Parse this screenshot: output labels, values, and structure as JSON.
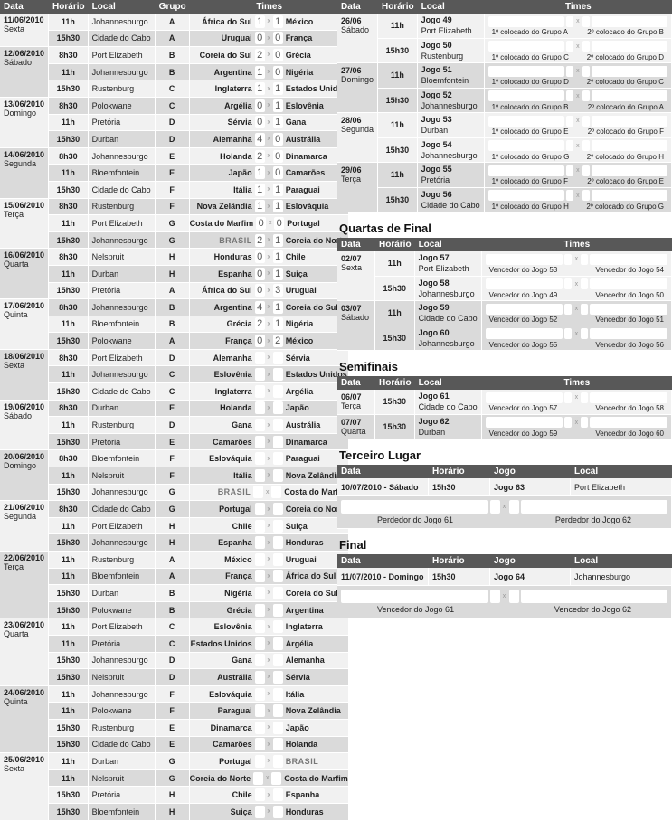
{
  "group_stage": {
    "headers": {
      "data": "Data",
      "horario": "Horário",
      "local": "Local",
      "grupo": "Grupo",
      "times": "Times"
    },
    "days": [
      {
        "date": "11/06/2010",
        "weekday": "Sexta",
        "matches": [
          {
            "time": "11h",
            "venue": "Johannesburgo",
            "group": "A",
            "home": "África do Sul",
            "hs": "1",
            "as": "1",
            "away": "México"
          },
          {
            "time": "15h30",
            "venue": "Cidade do Cabo",
            "group": "A",
            "home": "Uruguai",
            "hs": "0",
            "as": "0",
            "away": "França"
          }
        ]
      },
      {
        "date": "12/06/2010",
        "weekday": "Sábado",
        "matches": [
          {
            "time": "8h30",
            "venue": "Port Elizabeth",
            "group": "B",
            "home": "Coreia do Sul",
            "hs": "2",
            "as": "0",
            "away": "Grécia"
          },
          {
            "time": "11h",
            "venue": "Johannesburgo",
            "group": "B",
            "home": "Argentina",
            "hs": "1",
            "as": "0",
            "away": "Nigéria"
          },
          {
            "time": "15h30",
            "venue": "Rustenburg",
            "group": "C",
            "home": "Inglaterra",
            "hs": "1",
            "as": "1",
            "away": "Estados Unidos"
          }
        ]
      },
      {
        "date": "13/06/2010",
        "weekday": "Domingo",
        "matches": [
          {
            "time": "8h30",
            "venue": "Polokwane",
            "group": "C",
            "home": "Argélia",
            "hs": "0",
            "as": "1",
            "away": "Eslovênia"
          },
          {
            "time": "11h",
            "venue": "Pretória",
            "group": "D",
            "home": "Sérvia",
            "hs": "0",
            "as": "1",
            "away": "Gana"
          },
          {
            "time": "15h30",
            "venue": "Durban",
            "group": "D",
            "home": "Alemanha",
            "hs": "4",
            "as": "0",
            "away": "Austrália"
          }
        ]
      },
      {
        "date": "14/06/2010",
        "weekday": "Segunda",
        "matches": [
          {
            "time": "8h30",
            "venue": "Johannesburgo",
            "group": "E",
            "home": "Holanda",
            "hs": "2",
            "as": "0",
            "away": "Dinamarca"
          },
          {
            "time": "11h",
            "venue": "Bloemfontein",
            "group": "E",
            "home": "Japão",
            "hs": "1",
            "as": "0",
            "away": "Camarões"
          },
          {
            "time": "15h30",
            "venue": "Cidade do Cabo",
            "group": "F",
            "home": "Itália",
            "hs": "1",
            "as": "1",
            "away": "Paraguai"
          }
        ]
      },
      {
        "date": "15/06/2010",
        "weekday": "Terça",
        "matches": [
          {
            "time": "8h30",
            "venue": "Rustenburg",
            "group": "F",
            "home": "Nova Zelândia",
            "hs": "1",
            "as": "1",
            "away": "Eslováquia"
          },
          {
            "time": "11h",
            "venue": "Port Elizabeth",
            "group": "G",
            "home": "Costa do Marfim",
            "hs": "0",
            "as": "0",
            "away": "Portugal"
          },
          {
            "time": "15h30",
            "venue": "Johannesburgo",
            "group": "G",
            "home": "BRASIL",
            "hs": "2",
            "as": "1",
            "away": "Coreia do Norte"
          }
        ]
      },
      {
        "date": "16/06/2010",
        "weekday": "Quarta",
        "matches": [
          {
            "time": "8h30",
            "venue": "Nelspruit",
            "group": "H",
            "home": "Honduras",
            "hs": "0",
            "as": "1",
            "away": "Chile"
          },
          {
            "time": "11h",
            "venue": "Durban",
            "group": "H",
            "home": "Espanha",
            "hs": "0",
            "as": "1",
            "away": "Suiça"
          },
          {
            "time": "15h30",
            "venue": "Pretória",
            "group": "A",
            "home": "África do Sul",
            "hs": "0",
            "as": "3",
            "away": "Uruguai"
          }
        ]
      },
      {
        "date": "17/06/2010",
        "weekday": "Quinta",
        "matches": [
          {
            "time": "8h30",
            "venue": "Johannesburgo",
            "group": "B",
            "home": "Argentina",
            "hs": "4",
            "as": "1",
            "away": "Coreia do Sul"
          },
          {
            "time": "11h",
            "venue": "Bloemfontein",
            "group": "B",
            "home": "Grécia",
            "hs": "2",
            "as": "1",
            "away": "Nigéria"
          },
          {
            "time": "15h30",
            "venue": "Polokwane",
            "group": "A",
            "home": "França",
            "hs": "0",
            "as": "2",
            "away": "México"
          }
        ]
      },
      {
        "date": "18/06/2010",
        "weekday": "Sexta",
        "matches": [
          {
            "time": "8h30",
            "venue": "Port Elizabeth",
            "group": "D",
            "home": "Alemanha",
            "hs": "",
            "as": "",
            "away": "Sérvia"
          },
          {
            "time": "11h",
            "venue": "Johannesburgo",
            "group": "C",
            "home": "Eslovênia",
            "hs": "",
            "as": "",
            "away": "Estados Unidos"
          },
          {
            "time": "15h30",
            "venue": "Cidade do Cabo",
            "group": "C",
            "home": "Inglaterra",
            "hs": "",
            "as": "",
            "away": "Argélia"
          }
        ]
      },
      {
        "date": "19/06/2010",
        "weekday": "Sábado",
        "matches": [
          {
            "time": "8h30",
            "venue": "Durban",
            "group": "E",
            "home": "Holanda",
            "hs": "",
            "as": "",
            "away": "Japão"
          },
          {
            "time": "11h",
            "venue": "Rustenburg",
            "group": "D",
            "home": "Gana",
            "hs": "",
            "as": "",
            "away": "Austrália"
          },
          {
            "time": "15h30",
            "venue": "Pretória",
            "group": "E",
            "home": "Camarões",
            "hs": "",
            "as": "",
            "away": "Dinamarca"
          }
        ]
      },
      {
        "date": "20/06/2010",
        "weekday": "Domingo",
        "matches": [
          {
            "time": "8h30",
            "venue": "Bloemfontein",
            "group": "F",
            "home": "Eslováquia",
            "hs": "",
            "as": "",
            "away": "Paraguai"
          },
          {
            "time": "11h",
            "venue": "Nelspruit",
            "group": "F",
            "home": "Itália",
            "hs": "",
            "as": "",
            "away": "Nova Zelândia"
          },
          {
            "time": "15h30",
            "venue": "Johannesburgo",
            "group": "G",
            "home": "BRASIL",
            "hs": "",
            "as": "",
            "away": "Costa do Marfim"
          }
        ]
      },
      {
        "date": "21/06/2010",
        "weekday": "Segunda",
        "matches": [
          {
            "time": "8h30",
            "venue": "Cidade do Cabo",
            "group": "G",
            "home": "Portugal",
            "hs": "",
            "as": "",
            "away": "Coreia do Norte"
          },
          {
            "time": "11h",
            "venue": "Port Elizabeth",
            "group": "H",
            "home": "Chile",
            "hs": "",
            "as": "",
            "away": "Suiça"
          },
          {
            "time": "15h30",
            "venue": "Johannesburgo",
            "group": "H",
            "home": "Espanha",
            "hs": "",
            "as": "",
            "away": "Honduras"
          }
        ]
      },
      {
        "date": "22/06/2010",
        "weekday": "Terça",
        "matches": [
          {
            "time": "11h",
            "venue": "Rustenburg",
            "group": "A",
            "home": "México",
            "hs": "",
            "as": "",
            "away": "Uruguai"
          },
          {
            "time": "11h",
            "venue": "Bloemfontein",
            "group": "A",
            "home": "França",
            "hs": "",
            "as": "",
            "away": "África do Sul"
          },
          {
            "time": "15h30",
            "venue": "Durban",
            "group": "B",
            "home": "Nigéria",
            "hs": "",
            "as": "",
            "away": "Coreia do Sul"
          },
          {
            "time": "15h30",
            "venue": "Polokwane",
            "group": "B",
            "home": "Grécia",
            "hs": "",
            "as": "",
            "away": "Argentina"
          }
        ]
      },
      {
        "date": "23/06/2010",
        "weekday": "Quarta",
        "matches": [
          {
            "time": "11h",
            "venue": "Port Elizabeth",
            "group": "C",
            "home": "Eslovênia",
            "hs": "",
            "as": "",
            "away": "Inglaterra"
          },
          {
            "time": "11h",
            "venue": "Pretória",
            "group": "C",
            "home": "Estados Unidos",
            "hs": "",
            "as": "",
            "away": "Argélia"
          },
          {
            "time": "15h30",
            "venue": "Johannesburgo",
            "group": "D",
            "home": "Gana",
            "hs": "",
            "as": "",
            "away": "Alemanha"
          },
          {
            "time": "15h30",
            "venue": "Nelspruit",
            "group": "D",
            "home": "Austrália",
            "hs": "",
            "as": "",
            "away": "Sérvia"
          }
        ]
      },
      {
        "date": "24/06/2010",
        "weekday": "Quinta",
        "matches": [
          {
            "time": "11h",
            "venue": "Johannesburgo",
            "group": "F",
            "home": "Eslováquia",
            "hs": "",
            "as": "",
            "away": "Itália"
          },
          {
            "time": "11h",
            "venue": "Polokwane",
            "group": "F",
            "home": "Paraguai",
            "hs": "",
            "as": "",
            "away": "Nova Zelândia"
          },
          {
            "time": "15h30",
            "venue": "Rustenburg",
            "group": "E",
            "home": "Dinamarca",
            "hs": "",
            "as": "",
            "away": "Japão"
          },
          {
            "time": "15h30",
            "venue": "Cidade do Cabo",
            "group": "E",
            "home": "Camarões",
            "hs": "",
            "as": "",
            "away": "Holanda"
          }
        ]
      },
      {
        "date": "25/06/2010",
        "weekday": "Sexta",
        "matches": [
          {
            "time": "11h",
            "venue": "Durban",
            "group": "G",
            "home": "Portugal",
            "hs": "",
            "as": "",
            "away": "BRASIL"
          },
          {
            "time": "11h",
            "venue": "Nelspruit",
            "group": "G",
            "home": "Coreia do Norte",
            "hs": "",
            "as": "",
            "away": "Costa do Marfim"
          },
          {
            "time": "15h30",
            "venue": "Pretória",
            "group": "H",
            "home": "Chile",
            "hs": "",
            "as": "",
            "away": "Espanha"
          },
          {
            "time": "15h30",
            "venue": "Bloemfontein",
            "group": "H",
            "home": "Suiça",
            "hs": "",
            "as": "",
            "away": "Honduras"
          }
        ]
      }
    ]
  },
  "separator": "x",
  "knockout": {
    "headers": {
      "data": "Data",
      "horario": "Horário",
      "local": "Local",
      "times": "Times"
    },
    "round_of_16": {
      "title": "",
      "days": [
        {
          "date": "26/06",
          "weekday": "Sábado",
          "matches": [
            {
              "time": "11h",
              "game": "Jogo 49",
              "venue": "Port Elizabeth",
              "l1": "1º colocado do Grupo A",
              "l2": "2º colocado do Grupo B"
            },
            {
              "time": "15h30",
              "game": "Jogo 50",
              "venue": "Rustenburg",
              "l1": "1º colocado do Grupo C",
              "l2": "2º colocado do Grupo D"
            }
          ]
        },
        {
          "date": "27/06",
          "weekday": "Domingo",
          "matches": [
            {
              "time": "11h",
              "game": "Jogo 51",
              "venue": "Bloemfontein",
              "l1": "1º colocado do Grupo D",
              "l2": "2º colocado do Grupo C"
            },
            {
              "time": "15h30",
              "game": "Jogo 52",
              "venue": "Johannesburgo",
              "l1": "1º colocado do Grupo B",
              "l2": "2º colocado do Grupo A"
            }
          ]
        },
        {
          "date": "28/06",
          "weekday": "Segunda",
          "matches": [
            {
              "time": "11h",
              "game": "Jogo 53",
              "venue": "Durban",
              "l1": "1º colocado do Grupo E",
              "l2": "2º colocado do Grupo F"
            },
            {
              "time": "15h30",
              "game": "Jogo 54",
              "venue": "Johannesburgo",
              "l1": "1º colocado do Grupo G",
              "l2": "2º colocado do Grupo H"
            }
          ]
        },
        {
          "date": "29/06",
          "weekday": "Terça",
          "matches": [
            {
              "time": "11h",
              "game": "Jogo 55",
              "venue": "Pretória",
              "l1": "1º colocado do Grupo F",
              "l2": "2º colocado do Grupo E"
            },
            {
              "time": "15h30",
              "game": "Jogo 56",
              "venue": "Cidade do Cabo",
              "l1": "1º colocado do Grupo H",
              "l2": "2º colocado do Grupo G"
            }
          ]
        }
      ]
    },
    "quarterfinals": {
      "title": "Quartas de Final",
      "days": [
        {
          "date": "02/07",
          "weekday": "Sexta",
          "matches": [
            {
              "time": "11h",
              "game": "Jogo 57",
              "venue": "Port Elizabeth",
              "l1": "Vencedor do Jogo 53",
              "l2": "Vencedor do Jogo 54"
            },
            {
              "time": "15h30",
              "game": "Jogo 58",
              "venue": "Johannesburgo",
              "l1": "Vencedor do Jogo 49",
              "l2": "Vencedor do Jogo 50"
            }
          ]
        },
        {
          "date": "03/07",
          "weekday": "Sábado",
          "matches": [
            {
              "time": "11h",
              "game": "Jogo 59",
              "venue": "Cidade do Cabo",
              "l1": "Vencedor do Jogo 52",
              "l2": "Vencedor do Jogo 51"
            },
            {
              "time": "15h30",
              "game": "Jogo 60",
              "venue": "Johannesburgo",
              "l1": "Vencedor do Jogo 55",
              "l2": "Vencedor do Jogo 56"
            }
          ]
        }
      ]
    },
    "semifinals": {
      "title": "Semifinais",
      "days": [
        {
          "date": "06/07",
          "weekday": "Terça",
          "matches": [
            {
              "time": "15h30",
              "game": "Jogo 61",
              "venue": "Cidade do Cabo",
              "l1": "Vencedor do Jogo 57",
              "l2": "Vencedor do Jogo 58"
            }
          ]
        },
        {
          "date": "07/07",
          "weekday": "Quarta",
          "matches": [
            {
              "time": "15h30",
              "game": "Jogo 62",
              "venue": "Durban",
              "l1": "Vencedor do Jogo 59",
              "l2": "Vencedor do Jogo 60"
            }
          ]
        }
      ]
    }
  },
  "third_place": {
    "title": "Terceiro Lugar",
    "headers": {
      "data": "Data",
      "horario": "Horário",
      "jogo": "Jogo",
      "local": "Local"
    },
    "date": "10/07/2010 - Sábado",
    "time": "15h30",
    "game": "Jogo 63",
    "venue": "Port Elizabeth",
    "l1": "Perdedor do Jogo 61",
    "l2": "Perdedor do Jogo 62"
  },
  "final": {
    "title": "Final",
    "headers": {
      "data": "Data",
      "horario": "Horário",
      "jogo": "Jogo",
      "local": "Local"
    },
    "date": "11/07/2010 - Domingo",
    "time": "15h30",
    "game": "Jogo 64",
    "venue": "Johannesburgo",
    "l1": "Vencedor do Jogo 61",
    "l2": "Vencedor do Jogo 62"
  },
  "colors": {
    "header_bg": "#585858",
    "row_light": "#f1f1f1",
    "row_dark": "#dadada"
  }
}
